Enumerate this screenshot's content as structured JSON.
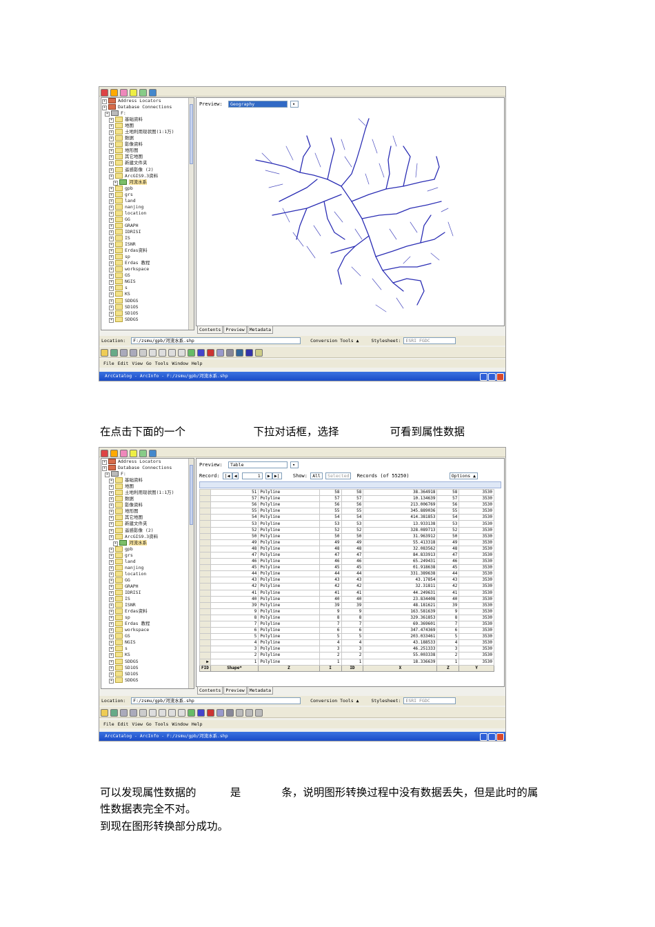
{
  "text": {
    "caption1": "在点击下面的一个                    下拉对话框，选择               可看到属性数据",
    "caption2_line1": "可以发现属性数据的          是            条，说明图形转换过程中没有数据丢失，但是此时的属",
    "caption2_line2": "性数据表完全不对。",
    "caption3": "到现在图形转换部分成功。"
  },
  "screenshot1": {
    "preview_label": "Preview:",
    "preview_value": "Geography",
    "tabs": [
      "Contents",
      "Preview",
      "Metadata"
    ],
    "location_label": "Location:",
    "location_value": "F:/zsmu/gpb/河流水系.shp",
    "conversion_tools": "Conversion Tools ▲",
    "stylesheet_label": "Stylesheet:",
    "stylesheet_value": "ESRI FGDC",
    "menu": [
      "File",
      "Edit",
      "View",
      "Go",
      "Tools",
      "Window",
      "Help"
    ],
    "title": "ArcCatalog - ArcInfo - F:/zsmu/gpb/河流水系.shp"
  },
  "screenshot2": {
    "preview_label": "Preview:",
    "preview_value": "Table",
    "record_label": "Record:",
    "record_value": "1",
    "show_label": "Show:",
    "show_all": "All",
    "show_selected": "Selected",
    "records_info": "Records (of 55250)",
    "options_label": "Options ▲",
    "tabs": [
      "Contents",
      "Preview",
      "Metadata"
    ],
    "location_label": "Location:",
    "location_value": "F:/zsmu/gpb/河流水系.shp",
    "conversion_tools": "Conversion Tools ▲",
    "stylesheet_label": "Stylesheet:",
    "stylesheet_value": "ESRI FGDC",
    "menu": [
      "File",
      "Edit",
      "View",
      "Go",
      "Tools",
      "Window",
      "Help"
    ],
    "title": "ArcCatalog - ArcInfo - F:/zsmu/gpb/河流水系.shp",
    "table": {
      "headers": [
        "FID",
        "Shape*",
        "Z",
        "I",
        "ID",
        "X",
        "Z",
        "Y"
      ],
      "rows": [
        [
          "51",
          "Polyline",
          "58",
          "58",
          "38.364918",
          "58",
          "3530"
        ],
        [
          "57",
          "Polyline",
          "57",
          "57",
          "10.134639",
          "57",
          "3530"
        ],
        [
          "56",
          "Polyline",
          "56",
          "56",
          "213.006769",
          "56",
          "3530"
        ],
        [
          "55",
          "Polyline",
          "55",
          "55",
          "345.889036",
          "55",
          "3530"
        ],
        [
          "54",
          "Polyline",
          "54",
          "54",
          "414.381853",
          "54",
          "3530"
        ],
        [
          "53",
          "Polyline",
          "53",
          "53",
          "13.933138",
          "53",
          "3530"
        ],
        [
          "52",
          "Polyline",
          "52",
          "52",
          "328.089713",
          "52",
          "3530"
        ],
        [
          "50",
          "Polyline",
          "50",
          "50",
          "31.963912",
          "50",
          "3530"
        ],
        [
          "49",
          "Polyline",
          "49",
          "49",
          "55.413318",
          "49",
          "3530"
        ],
        [
          "48",
          "Polyline",
          "48",
          "48",
          "32.083562",
          "48",
          "3530"
        ],
        [
          "47",
          "Polyline",
          "47",
          "47",
          "84.833913",
          "47",
          "3530"
        ],
        [
          "46",
          "Polyline",
          "46",
          "46",
          "65.249431",
          "46",
          "3530"
        ],
        [
          "45",
          "Polyline",
          "45",
          "45",
          "01.918638",
          "45",
          "3530"
        ],
        [
          "44",
          "Polyline",
          "44",
          "44",
          "331.389638",
          "44",
          "3530"
        ],
        [
          "43",
          "Polyline",
          "43",
          "43",
          "43.17854",
          "43",
          "3530"
        ],
        [
          "42",
          "Polyline",
          "42",
          "42",
          "32.31811",
          "42",
          "3530"
        ],
        [
          "41",
          "Polyline",
          "41",
          "41",
          "44.249631",
          "41",
          "3530"
        ],
        [
          "40",
          "Polyline",
          "40",
          "40",
          "23.834408",
          "40",
          "3530"
        ],
        [
          "39",
          "Polyline",
          "39",
          "39",
          "48.181621",
          "39",
          "3530"
        ],
        [
          "9",
          "Polyline",
          "9",
          "9",
          "163.581639",
          "9",
          "3530"
        ],
        [
          "8",
          "Polyline",
          "8",
          "8",
          "329.361853",
          "8",
          "3530"
        ],
        [
          "7",
          "Polyline",
          "7",
          "7",
          "69.369601",
          "7",
          "3530"
        ],
        [
          "6",
          "Polyline",
          "6",
          "6",
          "347.474369",
          "6",
          "3530"
        ],
        [
          "5",
          "Polyline",
          "5",
          "5",
          "203.033461",
          "5",
          "3530"
        ],
        [
          "4",
          "Polyline",
          "4",
          "4",
          "43.188533",
          "4",
          "3530"
        ],
        [
          "3",
          "Polyline",
          "3",
          "3",
          "46.251333",
          "3",
          "3530"
        ],
        [
          "2",
          "Polyline",
          "2",
          "2",
          "55.003338",
          "2",
          "3530"
        ],
        [
          "1",
          "Polyline",
          "1",
          "1",
          "18.336639",
          "1",
          "3530"
        ]
      ]
    }
  },
  "tree_items": [
    {
      "label": "Address Locators",
      "icon": "globe-icon"
    },
    {
      "label": "Database Connections",
      "icon": "database-icon"
    },
    {
      "label": "F:",
      "icon": "drive-icon"
    },
    {
      "label": "基础资料",
      "icon": "folder-icon"
    },
    {
      "label": "地图",
      "icon": "folder-icon"
    },
    {
      "label": "土地利用现状图(1:1万)",
      "icon": "folder-icon"
    },
    {
      "label": "数据",
      "icon": "folder-icon"
    },
    {
      "label": "影像资料",
      "icon": "folder-icon"
    },
    {
      "label": "地形图",
      "icon": "folder-icon"
    },
    {
      "label": "其它地图",
      "icon": "folder-icon"
    },
    {
      "label": "新建文件夹",
      "icon": "folder-icon"
    },
    {
      "label": "遥感影像 (2)",
      "icon": "folder-icon"
    },
    {
      "label": "ArcGIS9.3资料",
      "icon": "folder-icon"
    },
    {
      "label": "河流水系",
      "icon": "layer-icon"
    },
    {
      "label": "gpb",
      "icon": "folder-icon"
    },
    {
      "label": "grs",
      "icon": "folder-icon"
    },
    {
      "label": "land",
      "icon": "folder-icon"
    },
    {
      "label": "nanjing",
      "icon": "folder-icon"
    },
    {
      "label": "location",
      "icon": "folder-icon"
    },
    {
      "label": "GG",
      "icon": "folder-icon"
    },
    {
      "label": "GRAPH",
      "icon": "folder-icon"
    },
    {
      "label": "IDRISI",
      "icon": "folder-icon"
    },
    {
      "label": "IS",
      "icon": "folder-icon"
    },
    {
      "label": "ISNR",
      "icon": "folder-icon"
    },
    {
      "label": "Erdas资料",
      "icon": "folder-icon"
    },
    {
      "label": "sp",
      "icon": "folder-icon"
    },
    {
      "label": "Erdas 教程",
      "icon": "folder-icon"
    },
    {
      "label": "workspace",
      "icon": "folder-icon"
    },
    {
      "label": "GS",
      "icon": "folder-icon"
    },
    {
      "label": "NGIS",
      "icon": "folder-icon"
    },
    {
      "label": "s",
      "icon": "folder-icon"
    },
    {
      "label": "KS",
      "icon": "folder-icon"
    },
    {
      "label": "SDDGS",
      "icon": "folder-icon"
    },
    {
      "label": "SD1OS",
      "icon": "folder-icon"
    },
    {
      "label": "SD1OS",
      "icon": "folder-icon"
    },
    {
      "label": "SDDGS",
      "icon": "folder-icon"
    }
  ]
}
